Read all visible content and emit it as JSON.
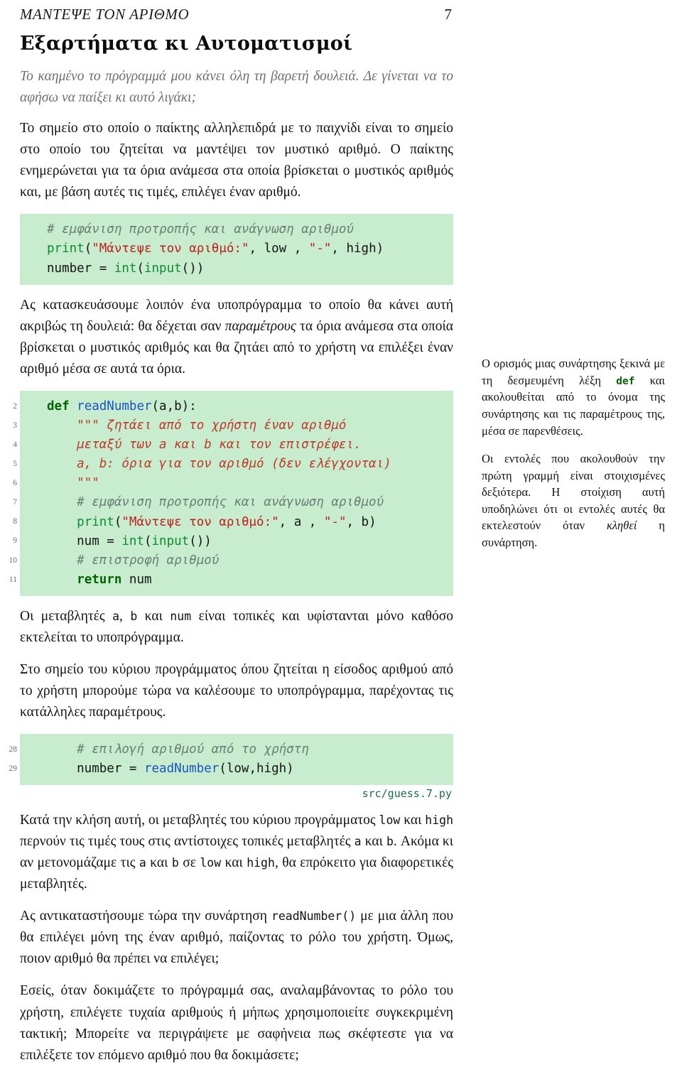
{
  "header": {
    "running_title": "ΜΑΝΤΕΨΕ ΤΟΝ ΑΡΙΘΜΟ",
    "page_number": "7"
  },
  "section": {
    "title": "Εξαρτήματα κι Αυτοματισμοί"
  },
  "epigraph": "Το καημένο το πρόγραμμά μου κάνει όλη τη βαρετή δουλειά. Δε γίνεται να το αφήσω να παίξει κι αυτό λιγάκι;",
  "paragraphs": {
    "p1": "Το σημείο στο οποίο ο παίκτης αλληλεπιδρά με το παιχνίδι είναι το σημείο στο οποίο του ζητείται να μαντέψει τον μυστικό αριθμό. Ο παίκτης ενημερώνεται για τα όρια ανάμεσα στα οποία βρίσκεται ο μυστικός αριθμός και, με βάση αυτές τις τιμές, επιλέγει έναν αριθμό.",
    "p2_a": "Ας κατασκευάσουμε λοιπόν ένα υποπρόγραμμα το οποίο θα κάνει αυτή ακριβώς τη δουλειά: θα δέχεται σαν ",
    "p2_em": "παραμέτρους",
    "p2_b": " τα όρια ανάμεσα στα οποία βρίσκεται ο μυστικός αριθμός και θα ζητάει από το χρήστη να επιλέξει έναν αριθμό μέσα σε αυτά τα όρια.",
    "p3_a": "Οι μεταβλητές ",
    "p3_c1": "a",
    "p3_b": ", ",
    "p3_c2": "b",
    "p3_d": " και ",
    "p3_c3": "num",
    "p3_e": " είναι τοπικές και υφίστανται μόνο καθόσο εκτελείται το υποπρόγραμμα.",
    "p4": "Στο σημείο του κύριου προγράμματος όπου ζητείται η είσοδος αριθμού από το χρήστη μπορούμε τώρα να καλέσουμε το υποπρόγραμμα, παρέχοντας τις κατάλληλες παραμέτρους.",
    "p5_a": "Κατά την κλήση αυτή, οι μεταβλητές του κύριου προγράμματος ",
    "p5_c1": "low",
    "p5_b": " και ",
    "p5_c2": "high",
    "p5_c": " περνούν τις τιμές τους στις αντίστοιχες τοπικές μεταβλητές ",
    "p5_c3": "a",
    "p5_d": " και ",
    "p5_c4": "b",
    "p5_e": ". Ακόμα κι αν μετονομάζαμε τις ",
    "p5_c5": "a",
    "p5_f": " και ",
    "p5_c6": "b",
    "p5_g": " σε ",
    "p5_c7": "low",
    "p5_h": " και ",
    "p5_c8": "high",
    "p5_i": ", θα επρόκειτο για διαφορετικές μεταβλητές.",
    "p6_a": "Ας αντικαταστήσουμε τώρα την συνάρτηση ",
    "p6_c1": "readNumber()",
    "p6_b": " με μια άλλη που θα επιλέγει μόνη της έναν αριθμό, παίζοντας το ρόλο του χρήστη. Όμως, ποιον αριθμό θα πρέπει να επιλέγει;",
    "p7": "Εσείς, όταν δοκιμάζετε το πρόγραμμά σας, αναλαμβάνοντας το ρόλο του χρήστη, επιλέγετε τυχαία αριθμούς ή μήπως χρησιμοποιείτε συγκεκριμένη τακτική; Μπορείτε να περιγράψετε με σαφήνεια πως σκέφτεστε για να επιλέξετε τον επόμενο αριθμό που θα δοκιμάσετε;"
  },
  "listing1": {
    "lines": [
      {
        "tokens": [
          {
            "t": "cmt",
            "s": "# εμφάνιση προτροπής και ανάγνωση αριθμού"
          }
        ]
      },
      {
        "tokens": [
          {
            "t": "builtin",
            "s": "print"
          },
          {
            "t": "plain",
            "s": "("
          },
          {
            "t": "str",
            "s": "\"Μάντεψε τον αριθμό:\""
          },
          {
            "t": "plain",
            "s": ", low , "
          },
          {
            "t": "str",
            "s": "\"-\""
          },
          {
            "t": "plain",
            "s": ", high)"
          }
        ]
      },
      {
        "tokens": [
          {
            "t": "plain",
            "s": "number = "
          },
          {
            "t": "builtin",
            "s": "int"
          },
          {
            "t": "plain",
            "s": "("
          },
          {
            "t": "builtin",
            "s": "input"
          },
          {
            "t": "plain",
            "s": "())"
          }
        ]
      }
    ]
  },
  "listing2": {
    "line_numbers": [
      "2",
      "3",
      "4",
      "5",
      "6",
      "7",
      "8",
      "9",
      "10",
      "11"
    ],
    "lines": [
      {
        "tokens": [
          {
            "t": "kw",
            "s": "def"
          },
          {
            "t": "plain",
            "s": " "
          },
          {
            "t": "fn",
            "s": "readNumber"
          },
          {
            "t": "plain",
            "s": "(a,b):"
          }
        ]
      },
      {
        "tokens": [
          {
            "t": "doc",
            "s": "    \"\"\" ζητάει από το χρήστη έναν αριθμό"
          }
        ]
      },
      {
        "tokens": [
          {
            "t": "doc",
            "s": "    μεταξύ των a και b και τον επιστρέφει."
          }
        ]
      },
      {
        "tokens": [
          {
            "t": "doc",
            "s": "    a, b: όρια για τον αριθμό (δεν ελέγχονται)"
          }
        ]
      },
      {
        "tokens": [
          {
            "t": "doc",
            "s": "    \"\"\""
          }
        ]
      },
      {
        "tokens": [
          {
            "t": "cmt",
            "s": "    # εμφάνιση προτροπής και ανάγνωση αριθμού"
          }
        ]
      },
      {
        "tokens": [
          {
            "t": "plain",
            "s": "    "
          },
          {
            "t": "builtin",
            "s": "print"
          },
          {
            "t": "plain",
            "s": "("
          },
          {
            "t": "str",
            "s": "\"Μάντεψε τον αριθμό:\""
          },
          {
            "t": "plain",
            "s": ", a , "
          },
          {
            "t": "str",
            "s": "\"-\""
          },
          {
            "t": "plain",
            "s": ", b)"
          }
        ]
      },
      {
        "tokens": [
          {
            "t": "plain",
            "s": "    num = "
          },
          {
            "t": "builtin",
            "s": "int"
          },
          {
            "t": "plain",
            "s": "("
          },
          {
            "t": "builtin",
            "s": "input"
          },
          {
            "t": "plain",
            "s": "())"
          }
        ]
      },
      {
        "tokens": [
          {
            "t": "cmt",
            "s": "    # επιστροφή αριθμού"
          }
        ]
      },
      {
        "tokens": [
          {
            "t": "plain",
            "s": "    "
          },
          {
            "t": "kw",
            "s": "return"
          },
          {
            "t": "plain",
            "s": " num"
          }
        ]
      }
    ]
  },
  "listing3": {
    "line_numbers": [
      "28",
      "29"
    ],
    "filename": "src/guess.7.py",
    "lines": [
      {
        "tokens": [
          {
            "t": "cmt",
            "s": "    # επιλογή αριθμού από το χρήστη"
          }
        ]
      },
      {
        "tokens": [
          {
            "t": "plain",
            "s": "    number = "
          },
          {
            "t": "fn",
            "s": "readNumber"
          },
          {
            "t": "plain",
            "s": "(low,high)"
          }
        ]
      }
    ]
  },
  "marginnote": {
    "p1_a": "Ο ορισμός μιας συνάρτησης ξεκινά με τη δεσμευμένη λέξη ",
    "p1_kw": "def",
    "p1_b": " και ακολουθείται από το όνομα της συνάρτησης και τις παραμέτρους της, μέσα σε παρενθέσεις.",
    "p2_a": "Οι εντολές που ακολουθούν την πρώτη γραμμή είναι στοιχισμένες δεξιότερα. Η στοίχιση αυτή υποδηλώνει ότι οι εντολές αυτές θα εκτελεστούν όταν ",
    "p2_em": "κληθεί",
    "p2_b": " η συνάρτηση."
  },
  "colors": {
    "code_background": "#c8ecce",
    "keyword": "#006400",
    "function_name": "#1a53c4",
    "builtin": "#0f8b32",
    "string": "#c02020",
    "docstring": "#c0392b",
    "comment": "#6b7f74",
    "filename_label": "#1d6b4f",
    "epigraph_text": "#6e6e6e",
    "line_number": "#6d6d6d"
  }
}
